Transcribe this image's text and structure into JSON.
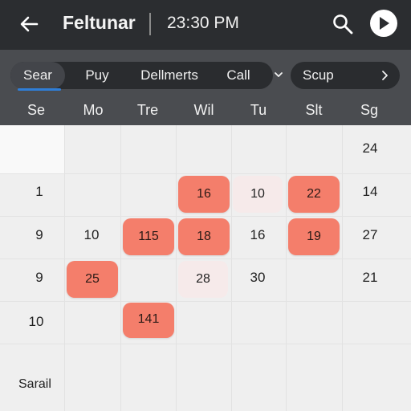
{
  "header": {
    "back_icon": "arrow-left-icon",
    "title": "Feltunar",
    "time": "23:30 PM",
    "search_icon": "search-icon",
    "play_icon": "play-icon"
  },
  "filters": {
    "segments": [
      "Sear",
      "Puy",
      "Dellmerts",
      "Call"
    ],
    "active_segment": "Sear",
    "dropdown_icon": "chevron-down-icon",
    "secondary": "Scup",
    "secondary_icon": "chevron-right-icon"
  },
  "weekdays": [
    "Se",
    "Mo",
    "Tre",
    "Wil",
    "Tu",
    "Slt",
    "Sg"
  ],
  "calendar": {
    "row1": {
      "c7": "24"
    },
    "row2": {
      "c1": "1",
      "c4": "16",
      "c5": "10",
      "c6": "22",
      "c7": "14"
    },
    "row3": {
      "c1": "9",
      "c2": "10",
      "c3": "115",
      "c4": "18",
      "c5": "16",
      "c6": "19",
      "c7": "27"
    },
    "row4": {
      "c1": "9",
      "c2": "25",
      "c4": "28",
      "c5": "30",
      "c7": "21"
    },
    "row5": {
      "c1": "10",
      "c3": "141"
    }
  },
  "colors": {
    "event": "#f47e6b",
    "header_bg": "#2b2d30",
    "accent": "#2f7ed8"
  },
  "footer": {
    "label": "Sarail"
  }
}
